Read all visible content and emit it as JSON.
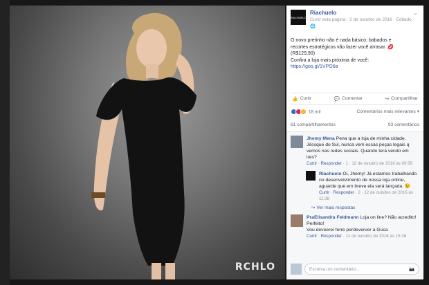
{
  "photo": {
    "watermark": "RCHLO"
  },
  "post": {
    "page_name": "Riachuelo",
    "page_logo_text": "RIACHUELO",
    "like_page": "Curtir esta página",
    "separator": "·",
    "date": "2 de outubro de 2016",
    "edited": "· Editado ·",
    "text_line1": "O novo pretinho não é nada básico: babados e",
    "text_line2": "recortes estratégicos vão fazer você arrasar.",
    "text_line3": "(R$129,90)",
    "text_line4": "Confira a loja mais próxima de você:",
    "link": "https://goo.gl/1VPO6a"
  },
  "actions": {
    "like": "Curtir",
    "comment": "Comentar",
    "share": "Compartilhar"
  },
  "reactions": {
    "count": "18 mil",
    "sort": "Comentários mais relevantes ▾"
  },
  "stats": {
    "shares": "61 compartilhamentos",
    "comments": "93 comentários"
  },
  "comments": [
    {
      "author": "Jhemy Mena",
      "text": "Pena que a loja de minha cidade, Jéssque do Sul, nunca vem essas peças legais q vemos nas redes sociais. Quando terá vendo em ires?",
      "like": "Curtir",
      "reply": "Responder",
      "likes": "1",
      "date": "12 de outubro de 2016 às 09:56"
    },
    {
      "author": "Riachuelo",
      "text": "Oi, Jhemy! Já estamos trabalhando no desenvolvimento de nossa loja online, aguarde que em breve ela será lançada. 😉",
      "like": "Curtir",
      "reply": "Responder",
      "likes": "2",
      "date": "12 de outubro de 2016 às 11:38"
    },
    {
      "author": "PraElisandra Feldmann",
      "text": "Loja on line? Não acredito! Perfeito!",
      "subtext": "Vou deveerei ferre perdeverver a Guca",
      "like": "Curtir",
      "reply": "Responder",
      "date": "12 de outubro de 2016 às 15:36"
    }
  ],
  "more_replies": "Ver mais respostas",
  "write_placeholder": "Escreva um comentário..."
}
